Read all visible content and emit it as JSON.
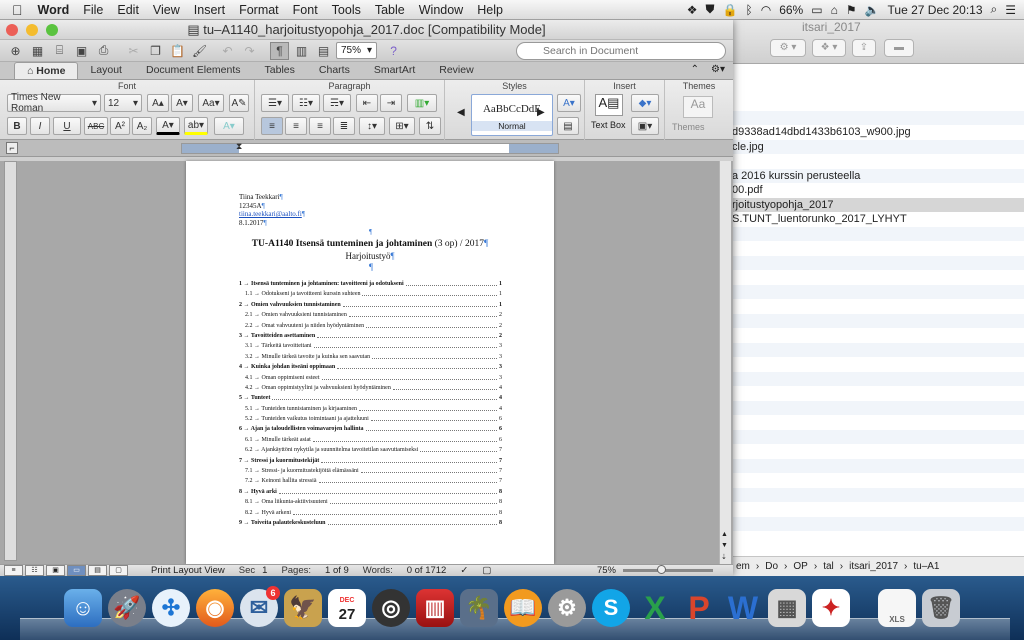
{
  "menubar": {
    "app": "Word",
    "items": [
      "File",
      "Edit",
      "View",
      "Insert",
      "Format",
      "Font",
      "Tools",
      "Table",
      "Window",
      "Help"
    ],
    "battery": "66%",
    "clock": "Tue 27 Dec  20:13"
  },
  "window": {
    "title": "tu–A1140_harjoitustyopohja_2017.doc [Compatibility Mode]",
    "zoom": "75%",
    "search_placeholder": "Search in Document"
  },
  "tabs": [
    "Home",
    "Layout",
    "Document Elements",
    "Tables",
    "Charts",
    "SmartArt",
    "Review"
  ],
  "ribbon": {
    "groups": {
      "font": "Font",
      "paragraph": "Paragraph",
      "styles": "Styles",
      "insert": "Insert",
      "themes": "Themes"
    },
    "font_name": "Times New Roman",
    "font_size": "12",
    "style_preview": "AaBbCcDdE",
    "style_name": "Normal",
    "textbox_label": "Text Box",
    "themes_label": "Themes",
    "bold": "B",
    "italic": "I",
    "underline": "U",
    "strike": "ABC",
    "superscript": "A²",
    "subscript": "A₂"
  },
  "ruler": {
    "ticks": [
      "2",
      "2",
      "4",
      "6",
      "8",
      "10",
      "12",
      "14",
      "16",
      "18"
    ]
  },
  "document": {
    "author": "Tiina Teekkari",
    "student_id": "12345A",
    "email": "tiina.teekkari@aalto.fi",
    "date": "8.1.2017",
    "title_bold": "TU-A1140 Itsensä tunteminen ja johtaminen",
    "title_rest": " (3 op) / 2017",
    "subtitle": "Harjoitustyö",
    "para_mark": "¶",
    "toc": [
      {
        "level": 1,
        "text": "1 → Itsensä tunteminen ja johtaminen: tavoitteeni ja odotukseni",
        "page": "1"
      },
      {
        "level": 2,
        "text": "1.1 → Odotukseni ja tavoitteeni kurssin suhteen",
        "page": "1"
      },
      {
        "level": 1,
        "text": "2 → Omien vahvuuksien tunnistaminen",
        "page": "1"
      },
      {
        "level": 2,
        "text": "2.1 → Omien vahvuuksieni tunnistaminen",
        "page": "2"
      },
      {
        "level": 2,
        "text": "2.2 → Omat vahvuuteni ja niiden hyödyntäminen",
        "page": "2"
      },
      {
        "level": 1,
        "text": "3 → Tavoitteiden asettaminen",
        "page": "2"
      },
      {
        "level": 2,
        "text": "3.1 → Tärkeitä tavoitteitani",
        "page": "3"
      },
      {
        "level": 2,
        "text": "3.2 → Minulle tärkeä tavoite ja kuinka sen saavutan",
        "page": "3"
      },
      {
        "level": 1,
        "text": "4 → Kuinka johdan itseäni oppimaan",
        "page": "3"
      },
      {
        "level": 2,
        "text": "4.1 → Oman oppimiseni esteet",
        "page": "3"
      },
      {
        "level": 2,
        "text": "4.2 → Oman oppimistyylini ja vahvuuksieni hyödyntäminen",
        "page": "4"
      },
      {
        "level": 1,
        "text": "5 → Tunteet",
        "page": "4"
      },
      {
        "level": 2,
        "text": "5.1 → Tunteiden tunnistaminen ja kirjaaminen",
        "page": "4"
      },
      {
        "level": 2,
        "text": "5.2 → Tunteiden vaikutus toimintaani ja ajatteluuni",
        "page": "6"
      },
      {
        "level": 1,
        "text": "6 → Ajan ja taloudellisten voimavarojen hallinta",
        "page": "6"
      },
      {
        "level": 2,
        "text": "6.1 → Minulle tärkeät asiat",
        "page": "6"
      },
      {
        "level": 2,
        "text": "6.2 → Ajankäyttöni nykytila ja suunnitelma tavoitetilan saavuttamiseksi",
        "page": "7"
      },
      {
        "level": 1,
        "text": "7 → Stressi ja kuormitustekijät",
        "page": "7"
      },
      {
        "level": 2,
        "text": "7.1 → Stressi- ja kuormitustekijöitä elämässäni",
        "page": "7"
      },
      {
        "level": 2,
        "text": "7.2 → Keinoni hallita stressiä",
        "page": "7"
      },
      {
        "level": 1,
        "text": "8 → Hyvä arki",
        "page": "8"
      },
      {
        "level": 2,
        "text": "8.1 → Oma liikunta-aktiivisuuteni",
        "page": "8"
      },
      {
        "level": 2,
        "text": "8.2 → Hyvä arkeni",
        "page": "8"
      },
      {
        "level": 1,
        "text": "9 → Toiveita palautekeskusteluun",
        "page": "8"
      }
    ]
  },
  "statusbar": {
    "view": "Print Layout View",
    "sec_label": "Sec",
    "sec": "1",
    "pages_label": "Pages:",
    "pages": "1 of 9",
    "words_label": "Words:",
    "words": "0 of 1712",
    "zoom": "75%"
  },
  "finder": {
    "title": "itsari_2017",
    "files": [
      "",
      "",
      "d9338ad14dbd1433b6103_w900.jpg",
      "cle.jpg",
      "",
      "a 2016 kurssin perusteella",
      "00.pdf",
      "rjoitustyopohja_2017",
      "S.TUNT_luentorunko_2017_LYHYT",
      "",
      "",
      "",
      "",
      "",
      "",
      "",
      "",
      "",
      "",
      "",
      "",
      "",
      "",
      "",
      "",
      "",
      "",
      "",
      "",
      "",
      ""
    ],
    "selected_index": 7,
    "path": [
      "em",
      "Do",
      "OP",
      "tal",
      "itsari_2017",
      "tu–A1"
    ]
  },
  "dock": {
    "mail_badge": "6",
    "calendar_day": "27",
    "calendar_month": "DEC",
    "xls_label": "XLS"
  }
}
